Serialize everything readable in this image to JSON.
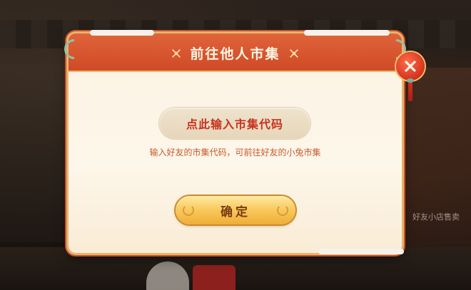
{
  "dialog": {
    "title": "前往他人市集",
    "code_input_label": "点此输入市集代码",
    "hint": "输入好友的市集代码，可前往好友的小兔市集",
    "confirm_label": "确定"
  },
  "background": {
    "shop_label": "好友小店售卖"
  },
  "colors": {
    "header_red": "#cf4a27",
    "code_text_red": "#c8321e",
    "button_gold": "#f8c85a",
    "close_red": "#d6321d"
  },
  "icons": {
    "title_left": "knot-icon",
    "title_right": "knot-icon",
    "close": "close-icon"
  }
}
